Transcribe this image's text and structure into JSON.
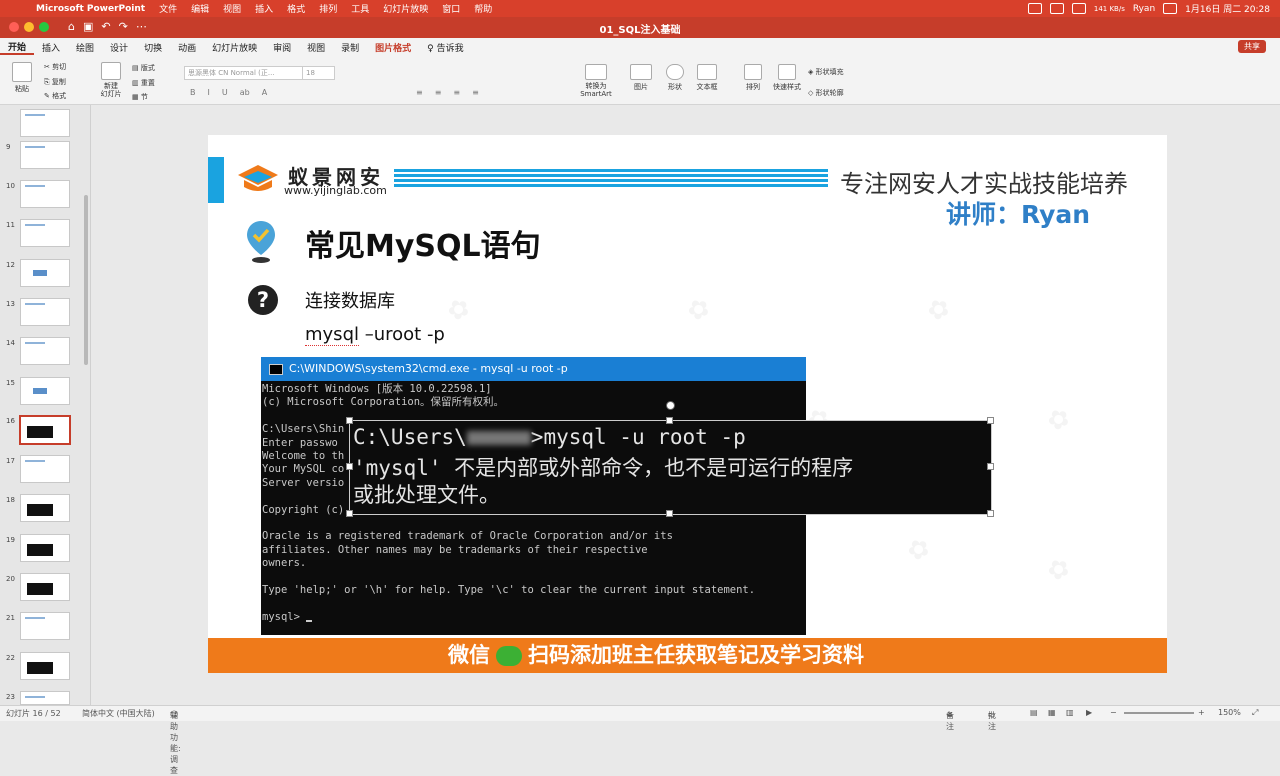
{
  "menubar": {
    "app_name": "Microsoft PowerPoint",
    "items": [
      "文件",
      "编辑",
      "视图",
      "插入",
      "格式",
      "排列",
      "工具",
      "幻灯片放映",
      "窗口",
      "帮助"
    ],
    "net_speed": "141 KB/s",
    "user": "Ryan",
    "datetime": "1月16日 周二 20:28"
  },
  "window": {
    "title": "01_SQL注入基础"
  },
  "ribbon": {
    "tabs": [
      "开始",
      "插入",
      "绘图",
      "设计",
      "切换",
      "动画",
      "幻灯片放映",
      "审阅",
      "视图",
      "录制",
      "图片格式"
    ],
    "tell_me": "告诉我",
    "share": "共享",
    "paste": "粘贴",
    "cut": "剪切",
    "copy": "复制",
    "format_painter": "格式",
    "new_slide": "新建\n幻灯片",
    "layout": "版式",
    "reset": "重置",
    "section": "节",
    "font_name": "思源黑体 CN Normal (正...",
    "font_size": "18",
    "convert_smartart": "转换为\nSmartArt",
    "picture": "图片",
    "shape": "形状",
    "textbox": "文本框",
    "arrange": "排列",
    "quick_styles": "快速样式",
    "shape_fill": "形状填充",
    "shape_outline": "形状轮廓"
  },
  "thumbnails": [
    {
      "num": "9",
      "type": "text"
    },
    {
      "num": "10",
      "type": "text"
    },
    {
      "num": "11",
      "type": "text"
    },
    {
      "num": "12",
      "type": "logo"
    },
    {
      "num": "13",
      "type": "text"
    },
    {
      "num": "14",
      "type": "text"
    },
    {
      "num": "15",
      "type": "logo"
    },
    {
      "num": "16",
      "type": "dark",
      "selected": true
    },
    {
      "num": "17",
      "type": "text"
    },
    {
      "num": "18",
      "type": "dark"
    },
    {
      "num": "19",
      "type": "dark"
    },
    {
      "num": "20",
      "type": "dark"
    },
    {
      "num": "21",
      "type": "text"
    },
    {
      "num": "22",
      "type": "dark"
    },
    {
      "num": "23",
      "type": "text"
    }
  ],
  "slide": {
    "brand": "蚁景网安",
    "url": "www.yijinglab.com",
    "slogan": "专注网安人才实战技能培养",
    "teacher": "讲师：Ryan",
    "heading": "常见MySQL语句",
    "subheading": "连接数据库",
    "command_prefix": "mysql",
    "command_rest": " –uroot -p",
    "cmd_title": "C:\\WINDOWS\\system32\\cmd.exe - mysql  -u root -p",
    "cmd_text": "Microsoft Windows [版本 10.0.22598.1]\n(c) Microsoft Corporation。保留所有权利。\n\nC:\\Users\\Shin\nEnter passwo\nWelcome to th\nYour MySQL co\nServer versio\n\nCopyright (c)\n\nOracle is a registered trademark of Oracle Corporation and/or its\naffiliates. Other names may be trademarks of their respective\nowners.\n\nType 'help;' or '\\h' for help. Type '\\c' to clear the current input statement.\n\nmysql> ",
    "zoom_line1_a": "C:\\Users\\",
    "zoom_line1_b": ">mysql -u root -p",
    "zoom_line2": "'mysql' 不是内部或外部命令，也不是可运行的程序",
    "zoom_line3": "或批处理文件。",
    "banner_a": "微信",
    "banner_b": "扫码添加班主任获取笔记及学习资料"
  },
  "statusbar": {
    "slide_counter": "幻灯片 16 / 52",
    "language": "简体中文 (中国大陆)",
    "accessibility": "辅助功能: 调查",
    "notes": "备注",
    "comments": "批注",
    "zoom": "150%"
  },
  "colors": {
    "accent": "#c63d2a",
    "brand_blue": "#1aa3e0",
    "banner_orange": "#ef7a1a"
  }
}
